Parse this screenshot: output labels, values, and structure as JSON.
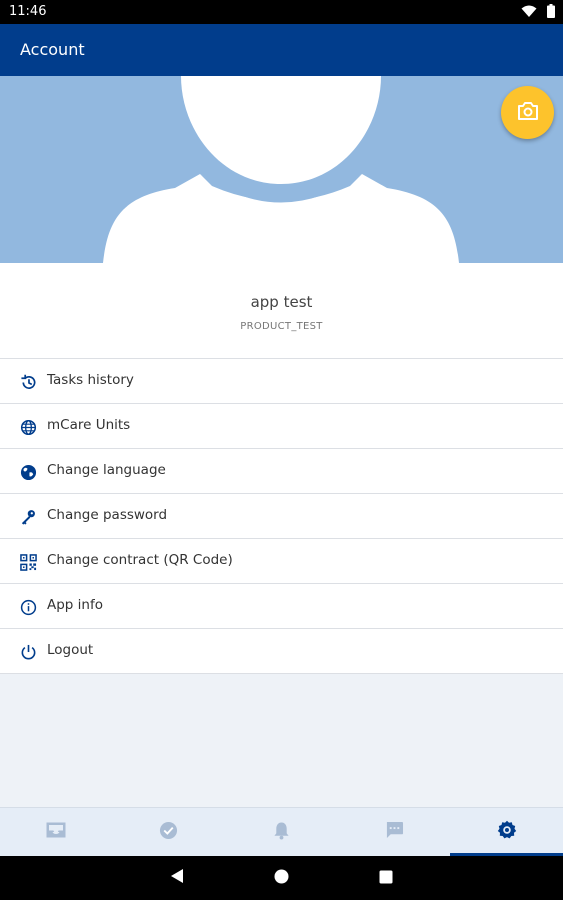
{
  "status_bar": {
    "time": "11:46"
  },
  "app_bar": {
    "title": "Account"
  },
  "profile": {
    "name": "app test",
    "company": "PRODUCT_TEST"
  },
  "menu": {
    "items": [
      {
        "label": "Tasks history",
        "icon": "history-icon"
      },
      {
        "label": "mCare Units",
        "icon": "globe-grid-icon"
      },
      {
        "label": "Change language",
        "icon": "globe-icon"
      },
      {
        "label": "Change password",
        "icon": "key-icon"
      },
      {
        "label": "Change contract (QR Code)",
        "icon": "qr-code-icon"
      },
      {
        "label": "App info",
        "icon": "info-icon"
      },
      {
        "label": "Logout",
        "icon": "power-icon"
      }
    ]
  },
  "bottom_nav": {
    "tabs": [
      {
        "icon": "inbox-icon",
        "active": false
      },
      {
        "icon": "check-circle-icon",
        "active": false
      },
      {
        "icon": "bell-icon",
        "active": false
      },
      {
        "icon": "chat-icon",
        "active": false
      },
      {
        "icon": "settings-icon",
        "active": true
      }
    ]
  },
  "colors": {
    "primary": "#013d8c",
    "banner": "#92b8df",
    "fab": "#fdc32c",
    "inactive_icon": "#a9bcd4"
  }
}
